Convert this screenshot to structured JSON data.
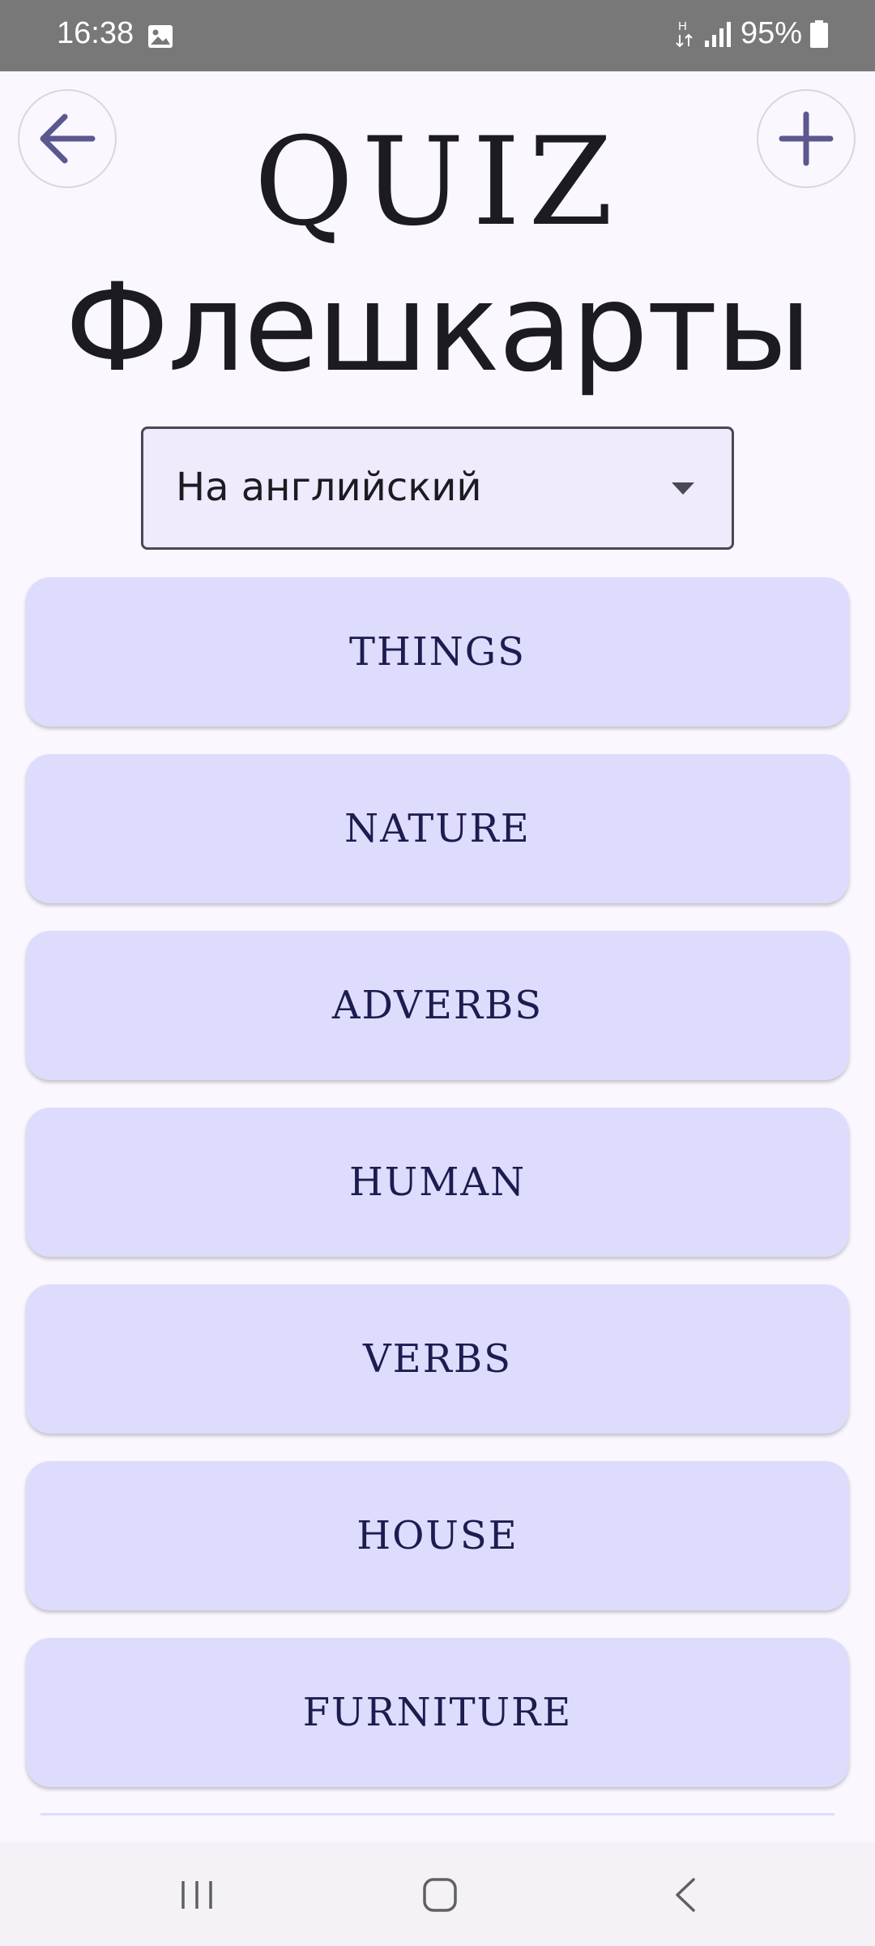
{
  "status_bar": {
    "time": "16:38",
    "battery": "95%",
    "icons": [
      "gallery-notification-icon",
      "network-h-icon",
      "signal-icon",
      "battery-icon"
    ]
  },
  "header": {
    "back_icon": "arrow-left-icon",
    "add_icon": "plus-icon",
    "brand": "QUIZ",
    "title": "Флешкарты"
  },
  "direction_select": {
    "selected": "На английский"
  },
  "categories": [
    {
      "label": "THINGS"
    },
    {
      "label": "NATURE"
    },
    {
      "label": "ADVERBS"
    },
    {
      "label": "HUMAN"
    },
    {
      "label": "VERBS"
    },
    {
      "label": "HOUSE"
    },
    {
      "label": "FURNITURE"
    }
  ],
  "colors": {
    "background": "#faf7ff",
    "card": "#dedcfd",
    "card_text": "#1d1b4f",
    "icon_accent": "#5b5890",
    "status_bar": "#787878"
  },
  "nav_bar": {
    "icons": [
      "recents-icon",
      "home-icon",
      "back-icon"
    ]
  }
}
